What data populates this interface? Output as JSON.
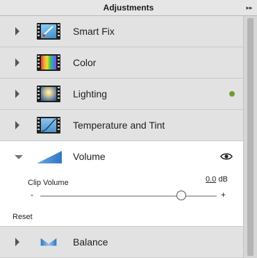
{
  "panel": {
    "title": "Adjustments",
    "collapse_glyph": "▸▸"
  },
  "rows": [
    {
      "label": "Smart Fix",
      "icon": "smart-fix-icon"
    },
    {
      "label": "Color",
      "icon": "color-icon"
    },
    {
      "label": "Lighting",
      "icon": "lighting-icon",
      "status": "active",
      "status_color": "#6b9e34"
    },
    {
      "label": "Temperature and Tint",
      "icon": "temperature-icon"
    }
  ],
  "volume": {
    "label": "Volume",
    "icon": "volume-icon",
    "slider_label": "Clip Volume",
    "value": "0.0",
    "unit": "dB",
    "min_symbol": "-",
    "max_symbol": "+",
    "slider_level": 0.8,
    "reset_label": "Reset"
  },
  "balance": {
    "label": "Balance",
    "icon": "balance-icon"
  },
  "colors": {
    "accent": "#2f77c4",
    "status_green": "#6b9e34"
  }
}
